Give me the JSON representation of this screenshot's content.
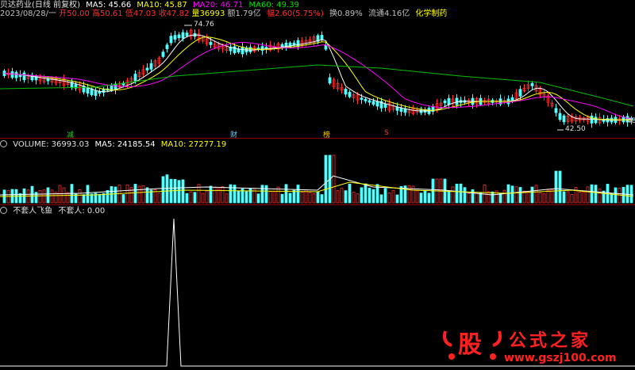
{
  "header": {
    "stock_name": "贝达药业(日线 前复权)",
    "ma5": "MA5: 45.66",
    "ma10": "MA10: 45.87",
    "ma20": "MA20: 46.71",
    "ma60": "MA60: 49.39"
  },
  "quote": {
    "date": "2023/08/28/一",
    "open": "开50.00",
    "high": "高50.61",
    "low": "低47.03",
    "close": "收47.82",
    "volume": "量36993",
    "amount": "额1.79亿",
    "change": "幅2.60(5.75%)",
    "turnover": "换0.89%",
    "float": "流通4.16亿",
    "sector": "化学制药"
  },
  "annotations": {
    "high_price": "74.76",
    "low_price": "42.50",
    "right_edge": "48"
  },
  "markers": [
    {
      "label": "减",
      "color": "#33cc33"
    },
    {
      "label": "财",
      "color": "#66ccff"
    },
    {
      "label": "榜",
      "color": "#ffcc00"
    },
    {
      "label": "S",
      "color": "#ff3333"
    }
  ],
  "volume_panel": {
    "title": "VOLUME: 36993.03",
    "ma5": "MA5: 24185.54",
    "ma10": "MA10: 27277.19"
  },
  "indicator_panel": {
    "title": "不套人飞鱼",
    "value": "不套人: 0.00"
  },
  "watermark": {
    "char": "股",
    "name": "公式之家",
    "url": "www.gszj100.com"
  },
  "colors": {
    "up": "#ff3030",
    "down": "#54ffff",
    "ma5": "#ffffff",
    "ma10": "#ffff00",
    "ma20": "#ff00ff",
    "ma60": "#00c000",
    "separator": "#8b0000"
  }
}
